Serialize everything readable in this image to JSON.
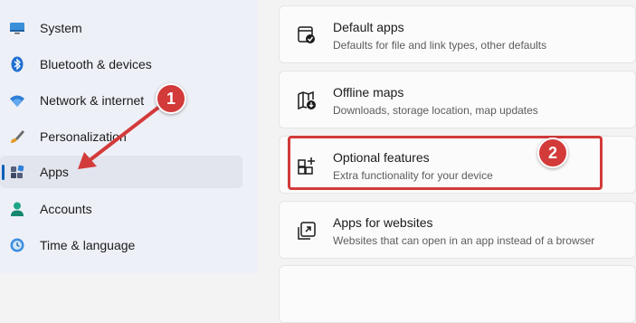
{
  "sidebar": {
    "items": [
      {
        "label": "System",
        "icon": "monitor-icon"
      },
      {
        "label": "Bluetooth & devices",
        "icon": "bluetooth-icon"
      },
      {
        "label": "Network & internet",
        "icon": "wifi-icon"
      },
      {
        "label": "Personalization",
        "icon": "brush-icon"
      },
      {
        "label": "Apps",
        "icon": "apps-icon",
        "selected": true
      },
      {
        "label": "Accounts",
        "icon": "person-icon"
      },
      {
        "label": "Time & language",
        "icon": "globe-clock-icon"
      }
    ]
  },
  "cards": [
    {
      "title": "Default apps",
      "subtitle": "Defaults for file and link types, other defaults",
      "icon": "default-apps-icon"
    },
    {
      "title": "Offline maps",
      "subtitle": "Downloads, storage location, map updates",
      "icon": "offline-maps-icon"
    },
    {
      "title": "Optional features",
      "subtitle": "Extra functionality for your device",
      "icon": "optional-features-icon"
    },
    {
      "title": "Apps for websites",
      "subtitle": "Websites that can open in an app instead of a browser",
      "icon": "apps-for-websites-icon"
    }
  ],
  "annotations": {
    "step1": "1",
    "step2": "2",
    "color": "#d33a3a"
  },
  "colors": {
    "accent": "#005fb8",
    "sidebar_bg": "#eef0f7"
  }
}
